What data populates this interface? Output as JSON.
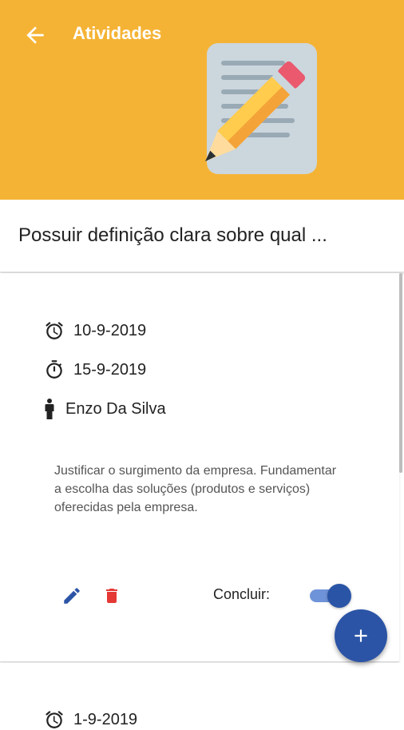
{
  "header": {
    "title": "Atividades",
    "background": "#f5b335",
    "back_icon": "arrow-left-icon",
    "hero_icon": "memo-pencil-icon"
  },
  "activity": {
    "title": "Possuir definição clara sobre qual ...",
    "start_date": "10-9-2019",
    "end_date": "15-9-2019",
    "responsible": "Enzo Da Silva",
    "description": "Justificar o surgimento da empresa. Fundamentar a escolha das soluções (produtos e serviços) oferecidas pela empresa.",
    "concluir_label": "Concluir:",
    "concluded": true
  },
  "next_activity": {
    "start_date": "1-9-2019"
  },
  "colors": {
    "accent": "#2b54a6",
    "delete": "#e53935",
    "toggle_track": "#6f93d8"
  }
}
